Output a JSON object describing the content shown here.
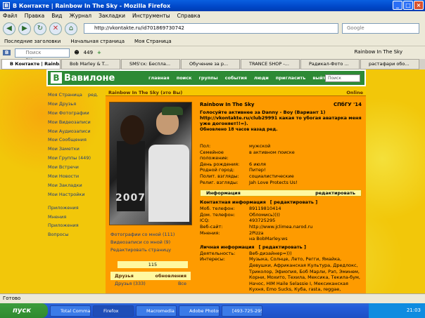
{
  "window": {
    "title": "В Контакте | Rainbow In The Sky - Mozilla Firefox"
  },
  "menu": [
    "Файл",
    "Правка",
    "Вид",
    "Журнал",
    "Закладки",
    "Инструменты",
    "Справка"
  ],
  "address": {
    "url": "http://vkontakte.ru/id701869730742"
  },
  "websearch": {
    "placeholder": "Google"
  },
  "bookmarks": [
    "Последние заголовки",
    "Начальная страница",
    "Моя Страница"
  ],
  "vktoolbar": {
    "search_placeholder": "Поиск ВКонтакте",
    "count": "449",
    "username": "Rainbow In The Sky"
  },
  "tabs": [
    "В Контакте | Rainb...",
    "Bob Marley & T...",
    "SMS'ск: Беспла...",
    "Обучение за р...",
    "TRANCE SHOP -...",
    "Радикал-Фото ...",
    "растафари обо..."
  ],
  "vk": {
    "logo_letter": "В",
    "site_name": "Вавилоне",
    "nav": [
      "главная",
      "поиск",
      "группы",
      "события",
      "люди",
      "пригласить",
      "выйти"
    ],
    "search_placeholder": "Поиск"
  },
  "leftmenu": {
    "my_page": "Моя Страница",
    "edit": "ред.",
    "items": [
      "Мои Друзья",
      "Мои Фотографии",
      "Мои Видеозаписи",
      "Мои Аудиозаписи",
      "Мои Сообщения",
      "Мои Заметки",
      "Мои Группы (449)",
      "Мои Встречи",
      "Мои Новости",
      "Мои Закладки",
      "Мои Настройки"
    ],
    "items2": [
      "Приложения",
      "Мнения",
      "Приложения",
      "Вопросы"
    ]
  },
  "profile": {
    "bar_title": "Rainbow In The Sky (это Вы)",
    "online": "Online",
    "name": "Rainbow In The Sky",
    "school": "СПбГУ '14",
    "status": "Голосуйте активнее за Danny - Boy (Вариант 1) http://vkontakte.ru/club29991 какая то убогая аватарка меня уже догоняет!!=).",
    "updated": "Обновлено 18 часов назад ред.",
    "info": [
      {
        "k": "Пол:",
        "v": "мужской"
      },
      {
        "k": "Семейное положение:",
        "v": "в активном поиске"
      },
      {
        "k": "День рождения:",
        "v": "6 июля"
      },
      {
        "k": "Родной город:",
        "v": "Питер!"
      },
      {
        "k": "Полит. взгляды:",
        "v": "социалистические"
      },
      {
        "k": "Религ. взгляды:",
        "v": "Jah Love Protects Us!"
      }
    ],
    "info_bar": {
      "title": "Информация",
      "action": "редактировать"
    },
    "contacts_head": "Контактная информация",
    "contacts_edit": "[ редактировать ]",
    "contacts": [
      {
        "k": "Моб. телефон:",
        "v": "89119810414"
      },
      {
        "k": "Дом. телефон:",
        "v": "Обломись))))"
      },
      {
        "k": "ICQ:",
        "v": "493725295"
      },
      {
        "k": "Веб-сайт:",
        "v": "http://www.jclimea.narod.ru"
      },
      {
        "k": "Мнения:",
        "v": "2Pizza"
      },
      {
        "k": "",
        "v": "на BobMarley.ws"
      }
    ],
    "personal_head": "Личная информация",
    "personal_edit": "[ редактировать ]",
    "personal": [
      {
        "k": "Деятельность:",
        "v": "Веб-дизайнер=)))"
      },
      {
        "k": "Интересы:",
        "v": "Музыка, Солнце, Лето, Регги, Ямайка, Девушки, Африканская Культура, Дредлокс, Триколор, Эфиопия, Боб Марли, Рэп, Эминем, Корни, Мохито, Техила, Мексика, Текила-бум, Начос, HIM Haile Selassie I, Мексиканская Кухня, Emo Sucks, Куба, rasta, reggae, Африка, афрокосы, брейды, восход"
      }
    ],
    "photo_caption": "2007",
    "links": [
      "Фотографии со мной (111)",
      "Видеозаписи со мной (9)",
      "Редактировать страницу"
    ],
    "counter": "115",
    "friends_head": "Друзья",
    "friends_updates": "обновления",
    "friends_row": "Друзья (333)",
    "friends_all": "Все"
  },
  "statusbar": {
    "text": "Готово"
  },
  "taskbar": {
    "start": "пуск",
    "tasks": [
      "Total Command...",
      "Firefox",
      "Macromedia Dre...",
      "Adobe Photoshop",
      "[493-725-295] -...",
      "RL",
      "Рабочий стол"
    ],
    "time": "21:03"
  }
}
